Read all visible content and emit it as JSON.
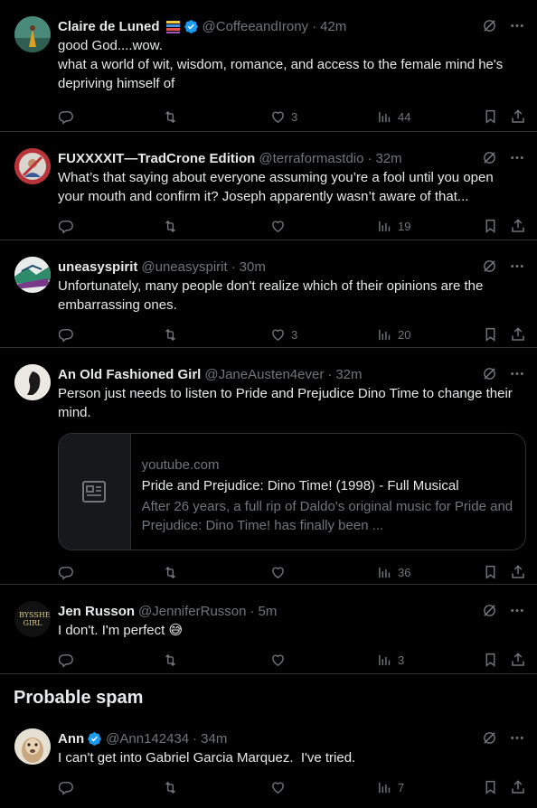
{
  "tweets": [
    {
      "name": "Claire de Luned",
      "handle": "@CoffeeandIrony",
      "time": "42m",
      "text": "good God....wow.\nwhat a world of wit, wisdom, romance, and access to the female mind he's depriving himself of",
      "likes": "3",
      "views": "44"
    },
    {
      "name": "FUXXXXIT—TradCrone Edition",
      "handle": "@terraformastdio",
      "time": "32m",
      "text": "What’s that saying about everyone assuming you’re a fool until you open your mouth and confirm it? Joseph apparently wasn’t aware of that...",
      "likes": "",
      "views": "19"
    },
    {
      "name": "uneasyspirit",
      "handle": "@uneasyspirit",
      "time": "30m",
      "text": "Unfortunately, many people don't realize which of their opinions are the embarrassing ones.",
      "likes": "3",
      "views": "20"
    },
    {
      "name": "An Old Fashioned Girl",
      "handle": "@JaneAusten4ever",
      "time": "32m",
      "text": "Person just needs to listen to Pride and Prejudice Dino Time to change their mind.",
      "likes": "",
      "views": "36",
      "card": {
        "domain": "youtube.com",
        "title": "Pride and Prejudice: Dino Time! (1998) - Full Musical",
        "desc": "After 26 years, a full rip of Daldo's original music for Pride and Prejudice: Dino Time! has finally been ..."
      }
    },
    {
      "name": "Jen Russon",
      "handle": "@JenniferRusson",
      "time": "5m",
      "text": "I don't. I'm perfect",
      "emoji": "😅",
      "likes": "",
      "views": "3",
      "avatar_text": "BYSSHE GIRL"
    }
  ],
  "section": {
    "title": "Probable spam"
  },
  "spam_tweet": {
    "name": "Ann",
    "handle": "@Ann142434",
    "time": "34m",
    "text": "I can't get into Gabriel Garcia Marquez.  I've tried.",
    "likes": "",
    "views": "7"
  },
  "dot_sep": "·",
  "colors": {
    "verified": "#1d9bf0",
    "muted": "#71767b",
    "border": "#2f3336"
  }
}
